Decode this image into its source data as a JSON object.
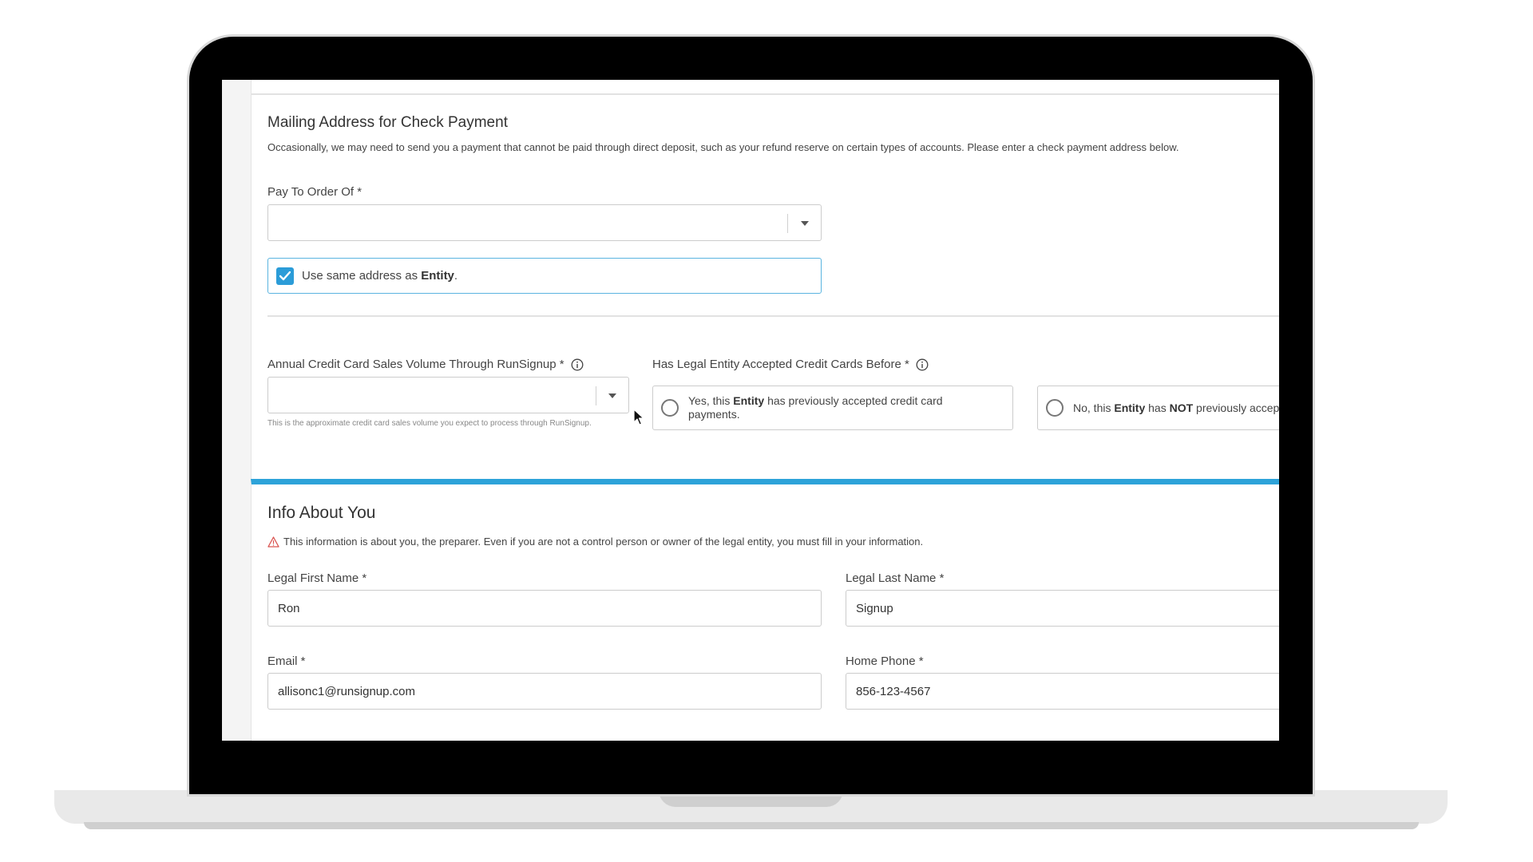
{
  "mailing": {
    "title": "Mailing Address for Check Payment",
    "description": "Occasionally, we may need to send you a payment that cannot be paid through direct deposit, such as your refund reserve on certain types of accounts. Please enter a check payment address below.",
    "pay_to_label": "Pay To Order Of *",
    "pay_to_value": "",
    "same_address": {
      "prefix": "Use same address as ",
      "bold": "Entity",
      "suffix": ".",
      "checked": true
    }
  },
  "credit": {
    "volume_label": "Annual Credit Card Sales Volume Through RunSignup *",
    "volume_value": "",
    "volume_hint": "This is the approximate credit card sales volume you expect to process through RunSignup.",
    "accepted_label": "Has Legal Entity Accepted Credit Cards Before *",
    "yes": {
      "prefix": "Yes, this ",
      "bold": "Entity",
      "suffix": " has previously accepted credit card payments."
    },
    "no": {
      "prefix": "No, this ",
      "bold1": "Entity",
      "middle": " has ",
      "bold2": "NOT",
      "suffix": " previously accepted credit card payments."
    }
  },
  "about": {
    "title": "Info About You",
    "warning": "This information is about you, the preparer. Even if you are not a control person or owner of the legal entity, you must fill in your information.",
    "first_name_label": "Legal First Name *",
    "first_name_value": "Ron",
    "last_name_label": "Legal Last Name *",
    "last_name_value": "Signup",
    "email_label": "Email *",
    "email_value": "allisonc1@runsignup.com",
    "phone_label": "Home Phone *",
    "phone_value": "856-123-4567"
  },
  "colors": {
    "accent": "#2da3d9",
    "checkbox": "#2b9cd8",
    "warning_icon": "#d9534f"
  },
  "icons": [
    "check-icon",
    "info-icon",
    "warning-icon",
    "chevron-down-icon",
    "mouse-cursor-icon"
  ]
}
